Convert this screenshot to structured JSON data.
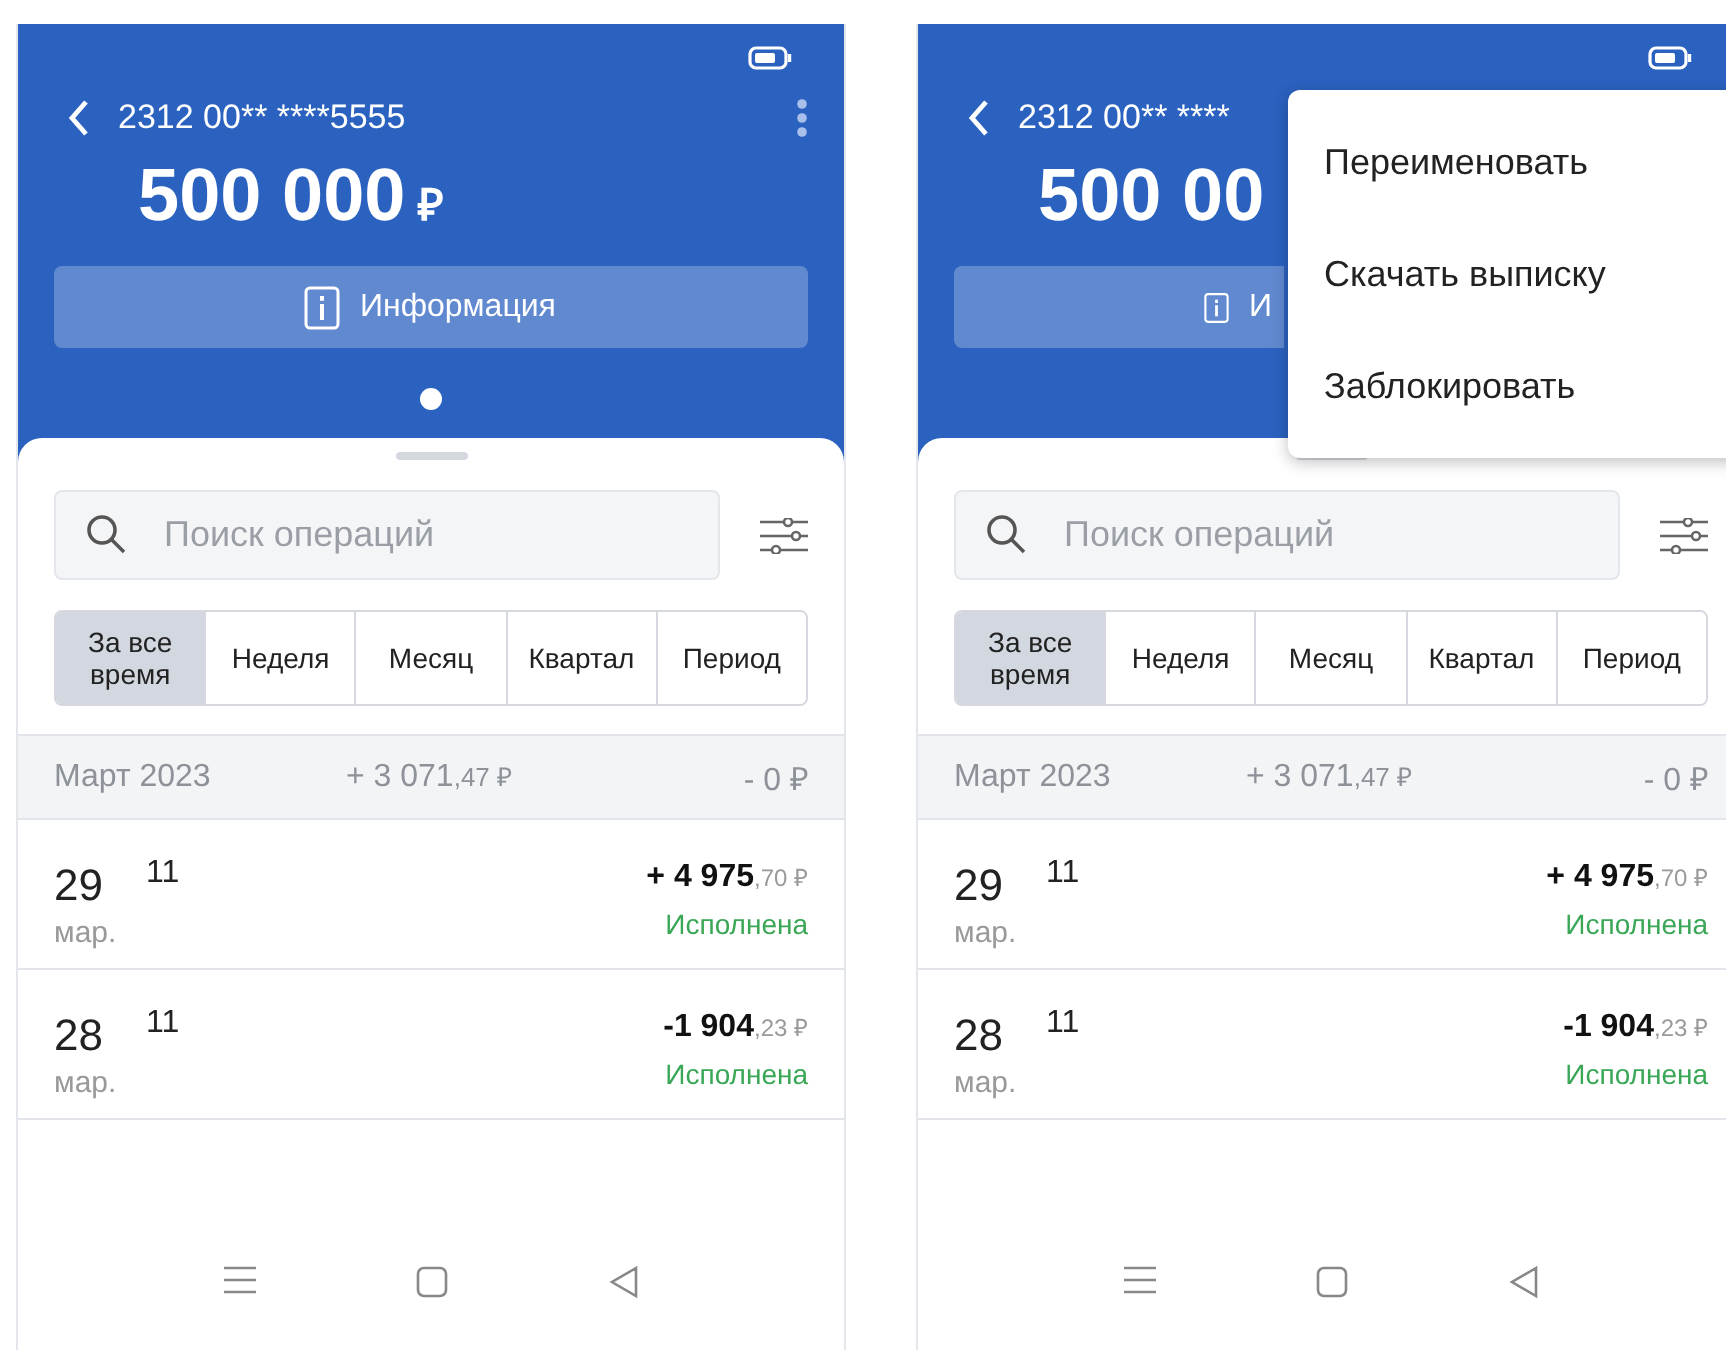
{
  "screens": [
    {
      "account_number": "2312 00** ****5555",
      "balance": "500 000",
      "currency": "₽",
      "info_button": "Информация",
      "search": {
        "placeholder": "Поиск операций"
      },
      "periods": [
        {
          "label": "За все время",
          "selected": true
        },
        {
          "label": "Неделя",
          "selected": false
        },
        {
          "label": "Месяц",
          "selected": false
        },
        {
          "label": "Квартал",
          "selected": false
        },
        {
          "label": "Период",
          "selected": false
        }
      ],
      "month": {
        "name": "Март 2023",
        "income": "+ 3 071",
        "income_fraction": ",47 ₽",
        "expense": "- 0 ₽"
      },
      "transactions": [
        {
          "day": "29",
          "month": "мар.",
          "title": "11",
          "amount": "+ 4 975",
          "fraction": ",70 ₽",
          "status": "Исполнена"
        },
        {
          "day": "28",
          "month": "мар.",
          "title": "11",
          "amount": "-1 904",
          "fraction": ",23 ₽",
          "status": "Исполнена"
        }
      ]
    },
    {
      "account_number": "2312 00** ****",
      "balance": "500 00",
      "info_button": "И",
      "search": {
        "placeholder": "Поиск операций"
      },
      "periods": [
        {
          "label": "За все время",
          "selected": true
        },
        {
          "label": "Неделя",
          "selected": false
        },
        {
          "label": "Месяц",
          "selected": false
        },
        {
          "label": "Квартал",
          "selected": false
        },
        {
          "label": "Период",
          "selected": false
        }
      ],
      "month": {
        "name": "Март 2023",
        "income": "+ 3 071",
        "income_fraction": ",47 ₽",
        "expense": "- 0 ₽"
      },
      "transactions": [
        {
          "day": "29",
          "month": "мар.",
          "title": "11",
          "amount": "+ 4 975",
          "fraction": ",70 ₽",
          "status": "Исполнена"
        },
        {
          "day": "28",
          "month": "мар.",
          "title": "11",
          "amount": "-1 904",
          "fraction": ",23 ₽",
          "status": "Исполнена"
        }
      ],
      "menu": [
        "Переименовать",
        "Скачать выписку",
        "Заблокировать"
      ]
    }
  ]
}
